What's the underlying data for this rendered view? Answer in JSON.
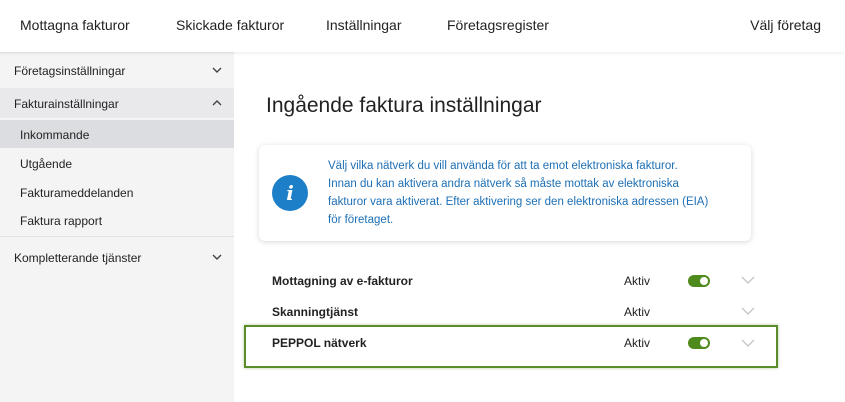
{
  "topnav": {
    "items": [
      "Mottagna fakturor",
      "Skickade fakturor",
      "Inställningar",
      "Företagsregister"
    ],
    "company_select": "Välj företag"
  },
  "sidebar": {
    "groups": [
      {
        "label": "Företagsinställningar",
        "icon": "chevron-down-icon",
        "expanded": false
      },
      {
        "label": "Fakturainställningar",
        "icon": "chevron-up-icon",
        "expanded": true
      },
      {
        "label": "Kompletterande tjänster",
        "icon": "chevron-down-icon",
        "expanded": false
      }
    ],
    "subitems": [
      "Inkommande",
      "Utgående",
      "Fakturameddelanden",
      "Faktura rapport"
    ],
    "selected_subitem": "Inkommande"
  },
  "main": {
    "title": "Ingående faktura inställningar",
    "info": {
      "icon": "info-icon",
      "lines": [
        "Välj vilka nätverk du vill använda för att ta emot elektroniska fakturor.",
        "Innan du kan aktivera andra nätverk så måste mottak av elektroniska",
        "fakturor vara aktiverat. Efter aktivering ser den elektroniska adressen (EIA)",
        "för företaget."
      ]
    },
    "settings": [
      {
        "name": "Mottagning av e-fakturor",
        "status": "Aktiv",
        "toggle_on": true
      },
      {
        "name": "Skanningtjänst",
        "status": "Aktiv",
        "toggle_on": false
      },
      {
        "name": "PEPPOL nätverk",
        "status": "Aktiv",
        "toggle_on": true
      }
    ]
  },
  "colors": {
    "accent_blue": "#1e7fc9",
    "info_text": "#1d6fb5",
    "toggle_green": "#4f8a1c",
    "highlight_border": "#5b8c2a"
  }
}
